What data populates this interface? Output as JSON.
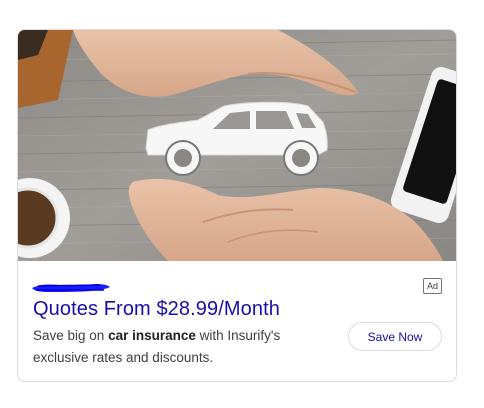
{
  "ad": {
    "badge": "Ad",
    "headline": "Quotes From $28.99/Month",
    "description": {
      "prefix": "Save big on ",
      "bold": "car insurance",
      "suffix": " with Insurify's exclusive rates and discounts."
    },
    "cta_label": "Save Now",
    "image_subject": "hands-around-car-cutout",
    "redaction_color": "#1a1aff",
    "headline_color": "#1a0dab"
  }
}
